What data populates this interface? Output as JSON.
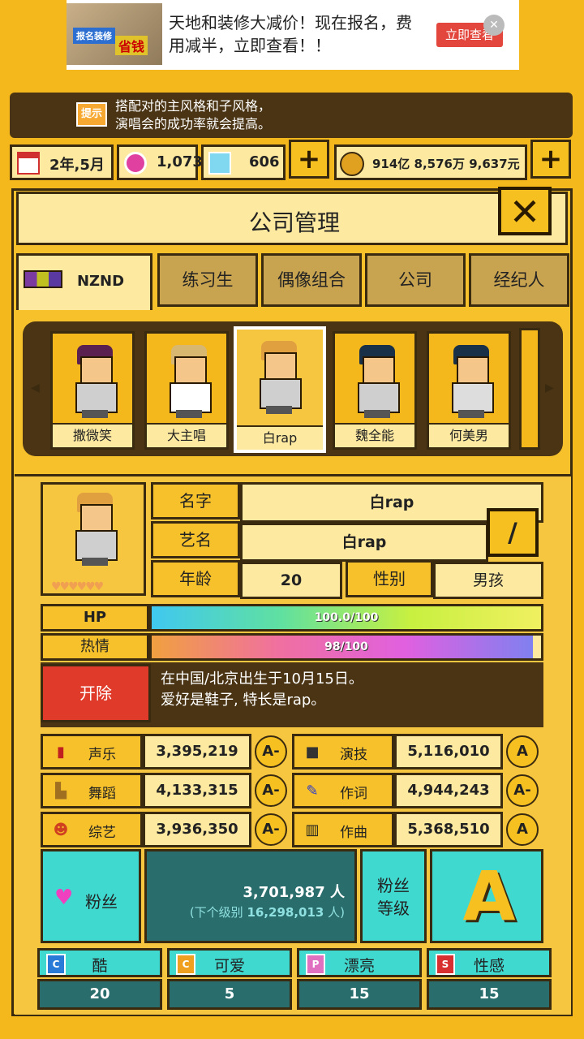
{
  "ad": {
    "text": "天地和装修大减价！现在报名，费用减半，立即查看！！",
    "button": "立即查看",
    "img_tag": "报名装修",
    "img_tag2": "省钱"
  },
  "hint": {
    "icon": "提示",
    "text_line1": "搭配对的主风格和子风格，",
    "text_line2": "演唱会的成功率就会提高。"
  },
  "resources": {
    "date": "2年,5月",
    "gems": "1,073",
    "diamonds": "606",
    "money": "914亿 8,576万 9,637元"
  },
  "panel": {
    "title": "公司管理"
  },
  "tabs": [
    {
      "label": "NZND",
      "active": true
    },
    {
      "label": "练习生",
      "active": false
    },
    {
      "label": "偶像组合",
      "active": false
    },
    {
      "label": "公司",
      "active": false
    },
    {
      "label": "经纪人",
      "active": false
    }
  ],
  "members": [
    {
      "name": "撒微笑",
      "hair": "#5a2050"
    },
    {
      "name": "大主唱",
      "hair": "#d8b870"
    },
    {
      "name": "白rap",
      "hair": "#e0a040",
      "selected": true
    },
    {
      "name": "魏全能",
      "hair": "#183048"
    },
    {
      "name": "何美男",
      "hair": "#183048"
    }
  ],
  "profile": {
    "name_label": "名字",
    "name": "白rap",
    "stage_label": "艺名",
    "stage_name": "白rap",
    "age_label": "年龄",
    "age": "20",
    "gender_label": "性别",
    "gender": "男孩"
  },
  "bars": {
    "hp_label": "HP",
    "hp_text": "100.0/100",
    "hp_fraction": 1.0,
    "passion_label": "热情",
    "passion_text": "98/100",
    "passion_fraction": 0.98
  },
  "fire_button": "开除",
  "bio": {
    "line1": "在中国/北京出生于10月15日。",
    "line2": "爱好是鞋子, 特长是rap。"
  },
  "stats": [
    {
      "label": "声乐",
      "value": "3,395,219",
      "grade": "A-",
      "icon": "mic-icon"
    },
    {
      "label": "演技",
      "value": "5,116,010",
      "grade": "A",
      "icon": "camera-icon"
    },
    {
      "label": "舞蹈",
      "value": "4,133,315",
      "grade": "A-",
      "icon": "shoe-icon"
    },
    {
      "label": "作词",
      "value": "4,944,243",
      "grade": "A-",
      "icon": "pen-icon"
    },
    {
      "label": "综艺",
      "value": "3,936,350",
      "grade": "A-",
      "icon": "smile-icon"
    },
    {
      "label": "作曲",
      "value": "5,368,510",
      "grade": "A",
      "icon": "piano-icon"
    }
  ],
  "fans": {
    "label": "粉丝",
    "count": "3,701,987 人",
    "next_prefix": "(下个级别",
    "next_value": "16,298,013",
    "next_suffix": "人)",
    "level_label_1": "粉丝",
    "level_label_2": "等级",
    "level_grade": "A"
  },
  "styles": [
    {
      "box": "C",
      "label": "酷",
      "value": "20",
      "color": "#2a7ad8"
    },
    {
      "box": "C",
      "label": "可爱",
      "value": "5",
      "color": "#f0a020"
    },
    {
      "box": "P",
      "label": "漂亮",
      "value": "15",
      "color": "#e070c0"
    },
    {
      "box": "S",
      "label": "性感",
      "value": "15",
      "color": "#d83030"
    }
  ]
}
